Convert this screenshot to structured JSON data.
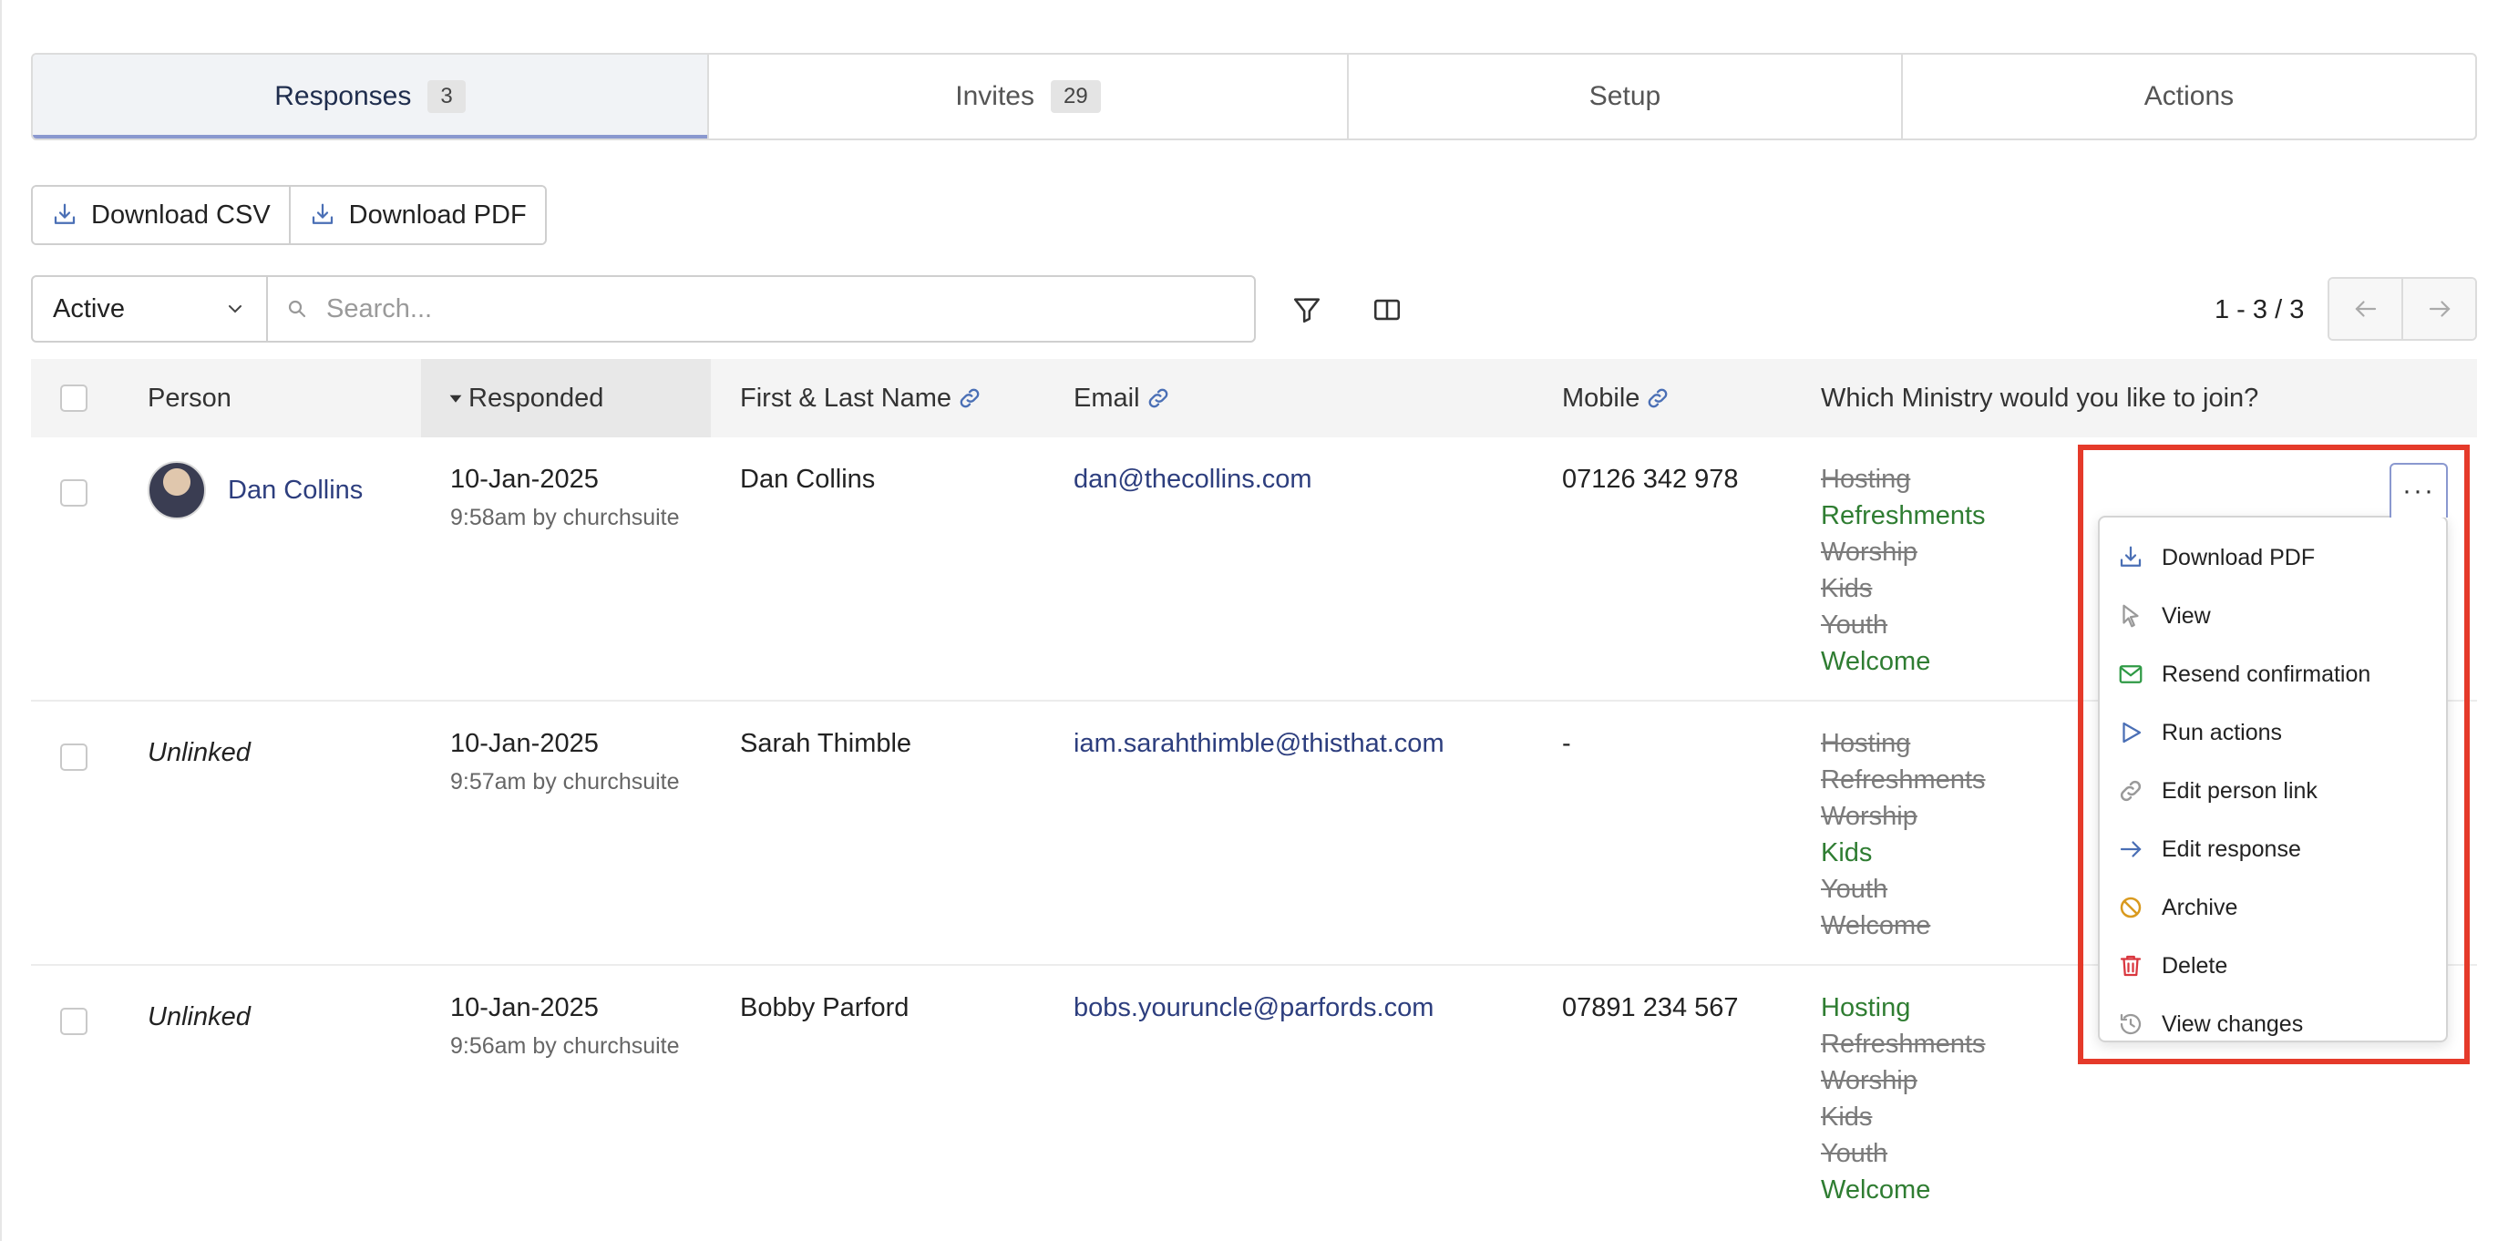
{
  "tabs": [
    {
      "label": "Responses",
      "count": "3",
      "active": true
    },
    {
      "label": "Invites",
      "count": "29"
    },
    {
      "label": "Setup"
    },
    {
      "label": "Actions"
    }
  ],
  "toolbar": {
    "download_csv": "Download CSV",
    "download_pdf": "Download PDF"
  },
  "filter": {
    "status": "Active",
    "search_placeholder": "Search...",
    "pagination": "1 - 3 / 3"
  },
  "columns": {
    "person": "Person",
    "responded": "Responded",
    "name": "First & Last Name",
    "email": "Email",
    "mobile": "Mobile",
    "ministry": "Which Ministry would you like to join?"
  },
  "rows": [
    {
      "person": "Dan Collins",
      "date": "10-Jan-2025",
      "time": "9:58am by churchsuite",
      "name": "Dan Collins",
      "email": "dan@thecollins.com",
      "mobile": "07126 342 978",
      "ministries": [
        "Hosting",
        "Refreshments",
        "Worship",
        "Kids",
        "Youth",
        "Welcome"
      ]
    },
    {
      "person": "Unlinked",
      "date": "10-Jan-2025",
      "time": "9:57am by churchsuite",
      "name": "Sarah Thimble",
      "email": "iam.sarahthimble@thisthat.com",
      "mobile": "-",
      "ministries": [
        "Hosting",
        "Refreshments",
        "Worship",
        "Kids",
        "Youth",
        "Welcome"
      ]
    },
    {
      "person": "Unlinked",
      "date": "10-Jan-2025",
      "time": "9:56am by churchsuite",
      "name": "Bobby Parford",
      "email": "bobs.youruncle@parfords.com",
      "mobile": "07891 234 567",
      "ministries": [
        "Hosting",
        "Refreshments",
        "Worship",
        "Kids",
        "Youth",
        "Welcome"
      ]
    }
  ],
  "menu": {
    "more_label": "···",
    "items": [
      {
        "label": "Download PDF",
        "icon": "download-icon"
      },
      {
        "label": "View",
        "icon": "pointer-icon"
      },
      {
        "label": "Resend confirmation",
        "icon": "envelope-icon"
      },
      {
        "label": "Run actions",
        "icon": "play-icon"
      },
      {
        "label": "Edit person link",
        "icon": "link-icon"
      },
      {
        "label": "Edit response",
        "icon": "arrow-right-icon"
      },
      {
        "label": "Archive",
        "icon": "archive-ban-icon"
      },
      {
        "label": "Delete",
        "icon": "trash-icon"
      },
      {
        "label": "View changes",
        "icon": "history-icon"
      }
    ]
  },
  "colors": {
    "accent": "#8a98cf",
    "link": "#2d3e7e",
    "selected_green": "#2f7d32",
    "highlight_red": "#e53a2a"
  }
}
